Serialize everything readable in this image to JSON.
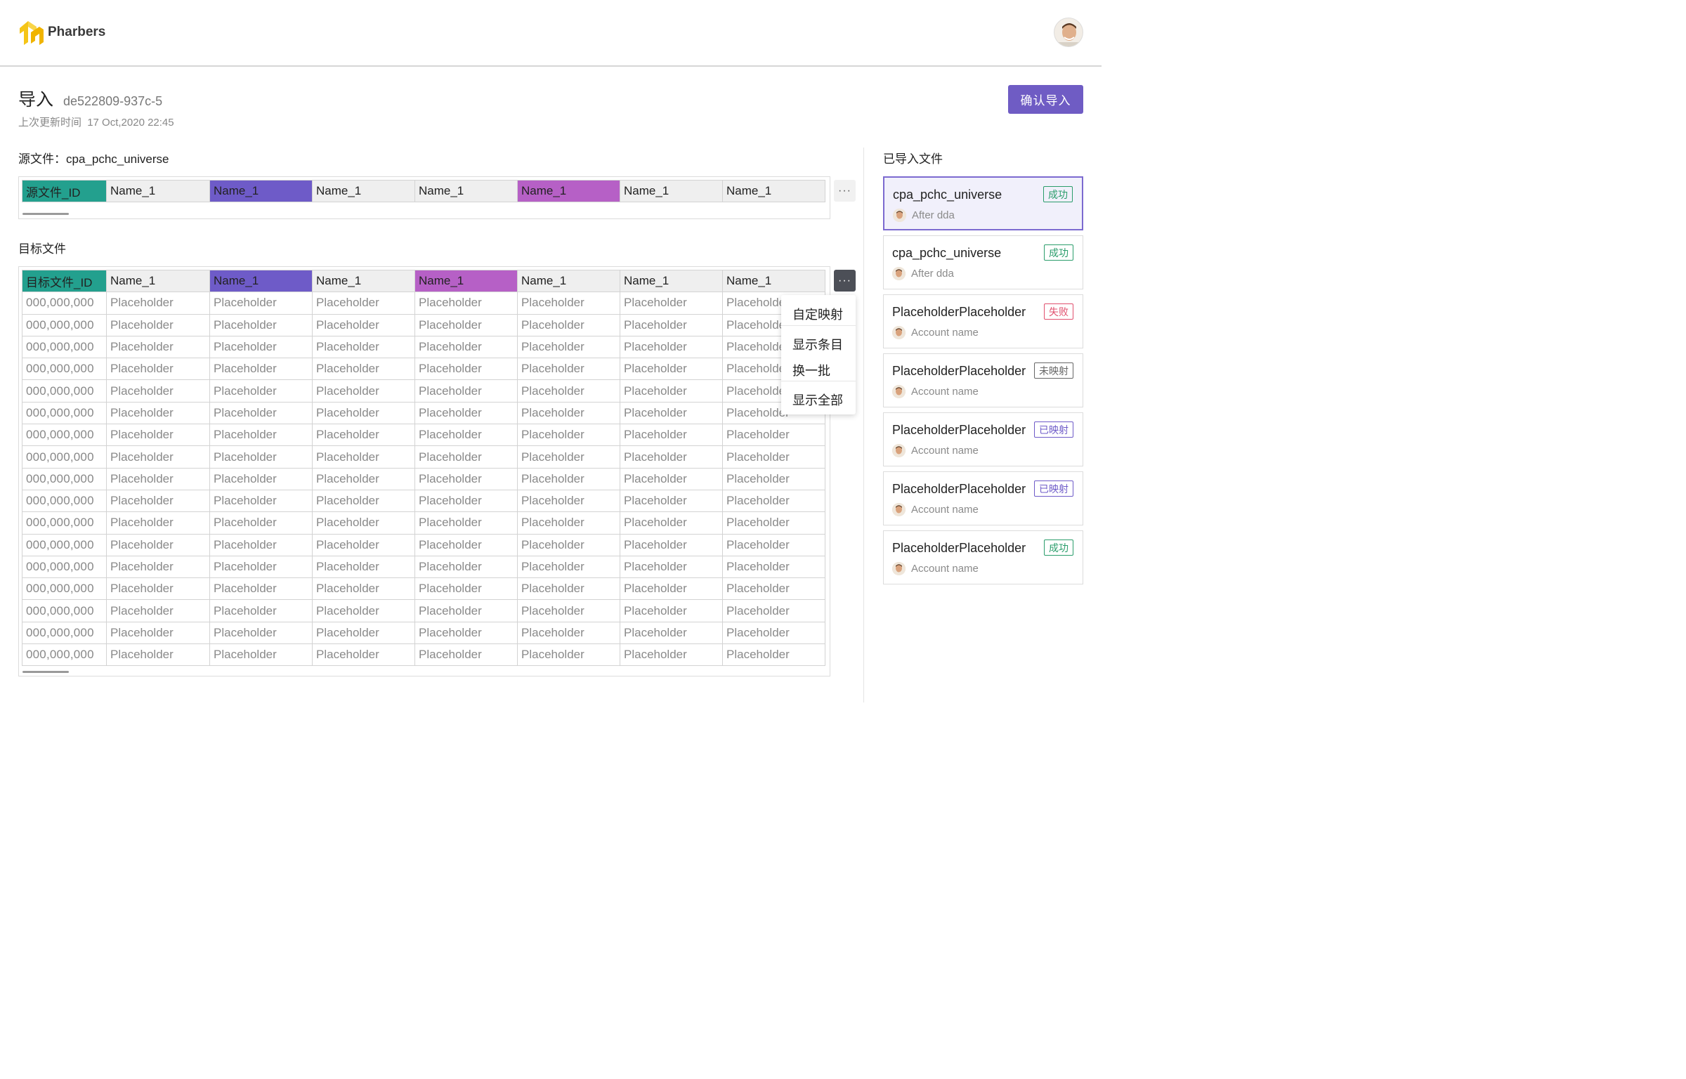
{
  "header": {
    "brand": "Pharbers"
  },
  "page": {
    "title": "导入",
    "id": "de522809-937c-5",
    "updated_label": "上次更新时间",
    "updated_value": "17 Oct,2020 22:45",
    "confirm_label": "确认导入"
  },
  "source": {
    "label": "源文件：cpa_pchc_universe",
    "columns": [
      {
        "label": "源文件_ID",
        "color": "#23a08e"
      },
      {
        "label": "Name_1",
        "color": ""
      },
      {
        "label": "Name_1",
        "color": "#6e5bc8"
      },
      {
        "label": "Name_1",
        "color": ""
      },
      {
        "label": "Name_1",
        "color": ""
      },
      {
        "label": "Name_1",
        "color": "#b660c6"
      },
      {
        "label": "Name_1",
        "color": ""
      },
      {
        "label": "Name_1",
        "color": ""
      }
    ],
    "more_label": "···"
  },
  "target": {
    "label": "目标文件",
    "columns": [
      {
        "label": "目标文件_ID",
        "color": "#23a08e"
      },
      {
        "label": "Name_1",
        "color": ""
      },
      {
        "label": "Name_1",
        "color": "#6e5bc8"
      },
      {
        "label": "Name_1",
        "color": ""
      },
      {
        "label": "Name_1",
        "color": "#b660c6"
      },
      {
        "label": "Name_1",
        "color": ""
      },
      {
        "label": "Name_1",
        "color": ""
      },
      {
        "label": "Name_1",
        "color": ""
      }
    ],
    "row_id": "000,000,000",
    "cell_value": "Placeholder",
    "row_count": 17,
    "more_label": "···"
  },
  "menu": {
    "items": [
      "自定映射",
      "显示条目",
      "换一批",
      "显示全部"
    ]
  },
  "imported": {
    "label": "已导入文件",
    "files": [
      {
        "name": "cpa_pchc_universe",
        "status": "成功",
        "status_type": "success",
        "account": "After dda",
        "selected": true
      },
      {
        "name": "cpa_pchc_universe",
        "status": "成功",
        "status_type": "success",
        "account": "After dda",
        "selected": false
      },
      {
        "name": "PlaceholderPlaceholder",
        "status": "失败",
        "status_type": "fail",
        "account": "Account name",
        "selected": false
      },
      {
        "name": "PlaceholderPlaceholder",
        "status": "未映射",
        "status_type": "unmapped",
        "account": "Account name",
        "selected": false
      },
      {
        "name": "PlaceholderPlaceholder",
        "status": "已映射",
        "status_type": "mapped",
        "account": "Account name",
        "selected": false
      },
      {
        "name": "PlaceholderPlaceholder",
        "status": "已映射",
        "status_type": "mapped",
        "account": "Account name",
        "selected": false
      },
      {
        "name": "PlaceholderPlaceholder",
        "status": "成功",
        "status_type": "success",
        "account": "Account name",
        "selected": false
      }
    ]
  }
}
